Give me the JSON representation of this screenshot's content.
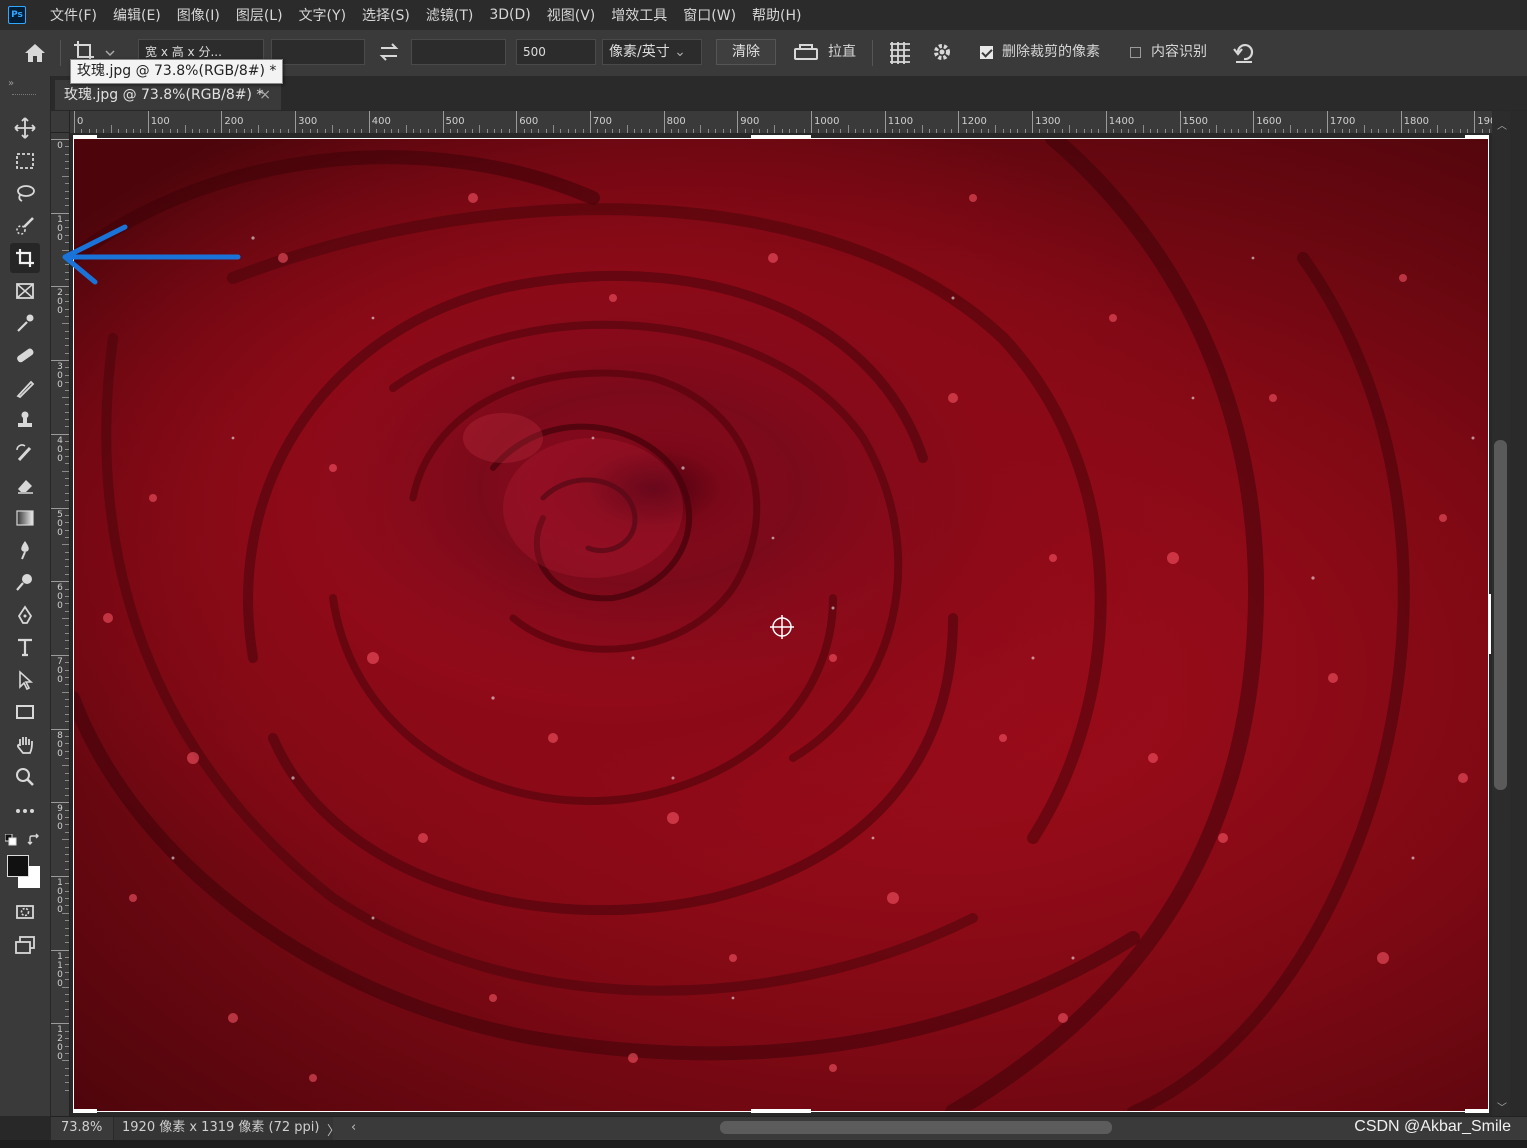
{
  "app": {
    "logo": "Ps"
  },
  "menu": [
    "文件(F)",
    "编辑(E)",
    "图像(I)",
    "图层(L)",
    "文字(Y)",
    "选择(S)",
    "滤镜(T)",
    "3D(D)",
    "视图(V)",
    "增效工具",
    "窗口(W)",
    "帮助(H)"
  ],
  "options": {
    "ratio_select": "宽 x 高 x 分...",
    "width_value": "",
    "height_value": "",
    "resolution_value": "500",
    "unit_select": "像素/英寸",
    "clear_label": "清除",
    "straighten_label": "拉直",
    "delete_cropped_label": "删除裁剪的像素",
    "delete_cropped_checked": true,
    "content_aware_label": "内容识别",
    "content_aware_checked": false
  },
  "tooltip": "玫瑰.jpg @ 73.8%(RGB/8#) *",
  "document_tab": {
    "title": "玫瑰.jpg @ 73.8%(RGB/8#) *",
    "close": "×"
  },
  "ruler_top": [
    "0",
    "100",
    "200",
    "300",
    "400",
    "500",
    "600",
    "700",
    "800",
    "900",
    "1000",
    "1100",
    "1200",
    "1300",
    "1400",
    "1500",
    "1600",
    "1700",
    "1800",
    "190"
  ],
  "ruler_left": [
    "0",
    "1\n0\n0",
    "2\n0\n0",
    "3\n0\n0",
    "4\n0\n0",
    "5\n0\n0",
    "6\n0\n0",
    "7\n0\n0",
    "8\n0\n0",
    "9\n0\n0",
    "1\n0\n0\n0",
    "1\n1\n0\n0",
    "1\n2\n0\n0"
  ],
  "tools": [
    "move-tool",
    "marquee-tool",
    "lasso-tool",
    "quick-select-tool",
    "crop-tool",
    "frame-tool",
    "eyedropper-tool",
    "healing-brush-tool",
    "brush-tool",
    "clone-stamp-tool",
    "history-brush-tool",
    "eraser-tool",
    "gradient-tool",
    "blur-tool",
    "dodge-tool",
    "pen-tool",
    "type-tool",
    "path-select-tool",
    "rectangle-tool",
    "hand-tool",
    "zoom-tool",
    "more-tools",
    "swap-colors",
    "color-swatches",
    "quick-mask",
    "screen-mode"
  ],
  "colors": {
    "foreground": "#111111",
    "background": "#ffffff",
    "annotation_arrow": "#1a73d8"
  },
  "status": {
    "zoom": "73.8%",
    "doc_info": "1920 像素 x 1319 像素 (72 ppi)",
    "arrow": "〉",
    "scroll_left": "‹"
  },
  "watermark": "CSDN @Akbar_Smile"
}
